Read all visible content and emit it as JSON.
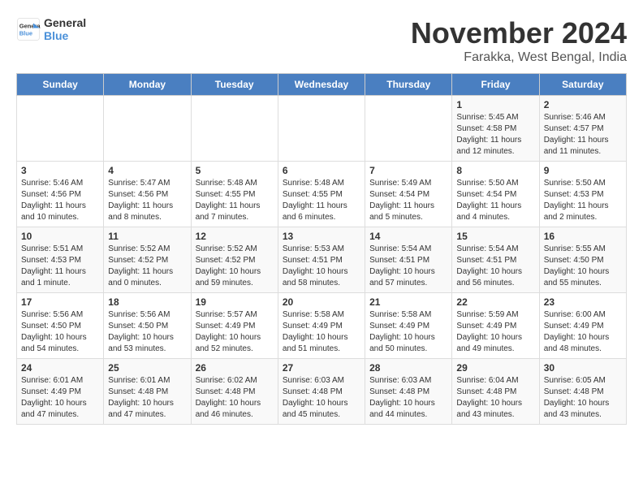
{
  "header": {
    "logo_line1": "General",
    "logo_line2": "Blue",
    "month_title": "November 2024",
    "location": "Farakka, West Bengal, India"
  },
  "weekdays": [
    "Sunday",
    "Monday",
    "Tuesday",
    "Wednesday",
    "Thursday",
    "Friday",
    "Saturday"
  ],
  "weeks": [
    [
      {
        "day": "",
        "detail": ""
      },
      {
        "day": "",
        "detail": ""
      },
      {
        "day": "",
        "detail": ""
      },
      {
        "day": "",
        "detail": ""
      },
      {
        "day": "",
        "detail": ""
      },
      {
        "day": "1",
        "detail": "Sunrise: 5:45 AM\nSunset: 4:58 PM\nDaylight: 11 hours\nand 12 minutes."
      },
      {
        "day": "2",
        "detail": "Sunrise: 5:46 AM\nSunset: 4:57 PM\nDaylight: 11 hours\nand 11 minutes."
      }
    ],
    [
      {
        "day": "3",
        "detail": "Sunrise: 5:46 AM\nSunset: 4:56 PM\nDaylight: 11 hours\nand 10 minutes."
      },
      {
        "day": "4",
        "detail": "Sunrise: 5:47 AM\nSunset: 4:56 PM\nDaylight: 11 hours\nand 8 minutes."
      },
      {
        "day": "5",
        "detail": "Sunrise: 5:48 AM\nSunset: 4:55 PM\nDaylight: 11 hours\nand 7 minutes."
      },
      {
        "day": "6",
        "detail": "Sunrise: 5:48 AM\nSunset: 4:55 PM\nDaylight: 11 hours\nand 6 minutes."
      },
      {
        "day": "7",
        "detail": "Sunrise: 5:49 AM\nSunset: 4:54 PM\nDaylight: 11 hours\nand 5 minutes."
      },
      {
        "day": "8",
        "detail": "Sunrise: 5:50 AM\nSunset: 4:54 PM\nDaylight: 11 hours\nand 4 minutes."
      },
      {
        "day": "9",
        "detail": "Sunrise: 5:50 AM\nSunset: 4:53 PM\nDaylight: 11 hours\nand 2 minutes."
      }
    ],
    [
      {
        "day": "10",
        "detail": "Sunrise: 5:51 AM\nSunset: 4:53 PM\nDaylight: 11 hours\nand 1 minute."
      },
      {
        "day": "11",
        "detail": "Sunrise: 5:52 AM\nSunset: 4:52 PM\nDaylight: 11 hours\nand 0 minutes."
      },
      {
        "day": "12",
        "detail": "Sunrise: 5:52 AM\nSunset: 4:52 PM\nDaylight: 10 hours\nand 59 minutes."
      },
      {
        "day": "13",
        "detail": "Sunrise: 5:53 AM\nSunset: 4:51 PM\nDaylight: 10 hours\nand 58 minutes."
      },
      {
        "day": "14",
        "detail": "Sunrise: 5:54 AM\nSunset: 4:51 PM\nDaylight: 10 hours\nand 57 minutes."
      },
      {
        "day": "15",
        "detail": "Sunrise: 5:54 AM\nSunset: 4:51 PM\nDaylight: 10 hours\nand 56 minutes."
      },
      {
        "day": "16",
        "detail": "Sunrise: 5:55 AM\nSunset: 4:50 PM\nDaylight: 10 hours\nand 55 minutes."
      }
    ],
    [
      {
        "day": "17",
        "detail": "Sunrise: 5:56 AM\nSunset: 4:50 PM\nDaylight: 10 hours\nand 54 minutes."
      },
      {
        "day": "18",
        "detail": "Sunrise: 5:56 AM\nSunset: 4:50 PM\nDaylight: 10 hours\nand 53 minutes."
      },
      {
        "day": "19",
        "detail": "Sunrise: 5:57 AM\nSunset: 4:49 PM\nDaylight: 10 hours\nand 52 minutes."
      },
      {
        "day": "20",
        "detail": "Sunrise: 5:58 AM\nSunset: 4:49 PM\nDaylight: 10 hours\nand 51 minutes."
      },
      {
        "day": "21",
        "detail": "Sunrise: 5:58 AM\nSunset: 4:49 PM\nDaylight: 10 hours\nand 50 minutes."
      },
      {
        "day": "22",
        "detail": "Sunrise: 5:59 AM\nSunset: 4:49 PM\nDaylight: 10 hours\nand 49 minutes."
      },
      {
        "day": "23",
        "detail": "Sunrise: 6:00 AM\nSunset: 4:49 PM\nDaylight: 10 hours\nand 48 minutes."
      }
    ],
    [
      {
        "day": "24",
        "detail": "Sunrise: 6:01 AM\nSunset: 4:49 PM\nDaylight: 10 hours\nand 47 minutes."
      },
      {
        "day": "25",
        "detail": "Sunrise: 6:01 AM\nSunset: 4:48 PM\nDaylight: 10 hours\nand 47 minutes."
      },
      {
        "day": "26",
        "detail": "Sunrise: 6:02 AM\nSunset: 4:48 PM\nDaylight: 10 hours\nand 46 minutes."
      },
      {
        "day": "27",
        "detail": "Sunrise: 6:03 AM\nSunset: 4:48 PM\nDaylight: 10 hours\nand 45 minutes."
      },
      {
        "day": "28",
        "detail": "Sunrise: 6:03 AM\nSunset: 4:48 PM\nDaylight: 10 hours\nand 44 minutes."
      },
      {
        "day": "29",
        "detail": "Sunrise: 6:04 AM\nSunset: 4:48 PM\nDaylight: 10 hours\nand 43 minutes."
      },
      {
        "day": "30",
        "detail": "Sunrise: 6:05 AM\nSunset: 4:48 PM\nDaylight: 10 hours\nand 43 minutes."
      }
    ]
  ]
}
